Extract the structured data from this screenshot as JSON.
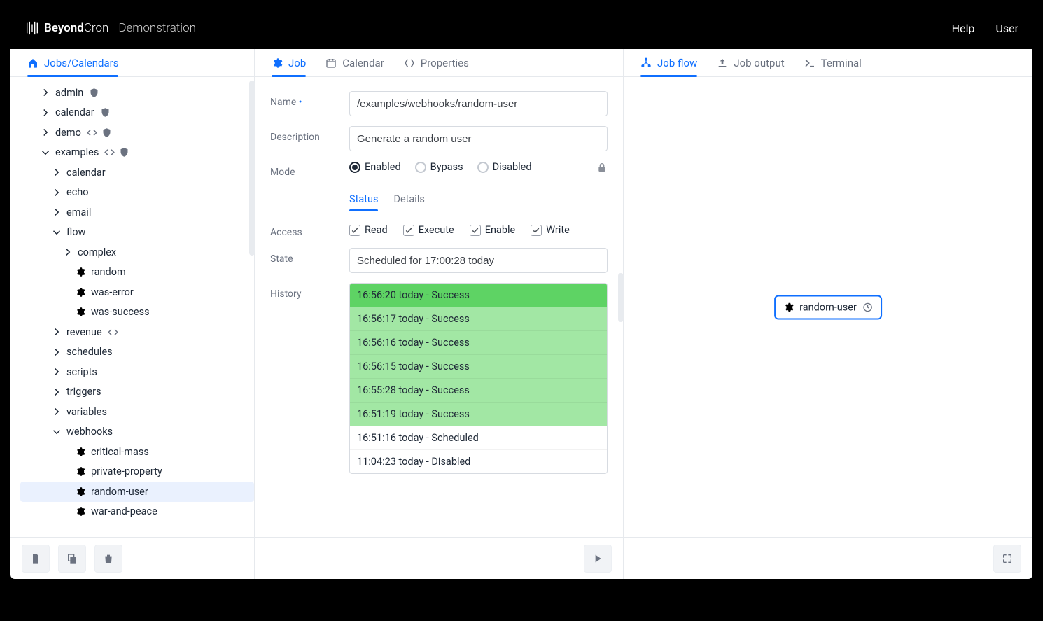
{
  "brand": {
    "bold": "Beyond",
    "thin": "Cron",
    "tenant": "Demonstration"
  },
  "header": {
    "help": "Help",
    "user": "User"
  },
  "leftTabs": {
    "jobs": "Jobs/Calendars"
  },
  "tree": {
    "admin": "admin",
    "calendar": "calendar",
    "demo": "demo",
    "examples": "examples",
    "ex_calendar": "calendar",
    "echo": "echo",
    "email": "email",
    "flow": "flow",
    "complex": "complex",
    "random": "random",
    "was_error": "was-error",
    "was_success": "was-success",
    "revenue": "revenue",
    "schedules": "schedules",
    "scripts": "scripts",
    "triggers": "triggers",
    "variables": "variables",
    "webhooks": "webhooks",
    "critical_mass": "critical-mass",
    "private_property": "private-property",
    "random_user": "random-user",
    "war_and_peace": "war-and-peace"
  },
  "midTabs": {
    "job": "Job",
    "calendar": "Calendar",
    "properties": "Properties"
  },
  "form": {
    "name_label": "Name",
    "name_value": "/examples/webhooks/random-user",
    "desc_label": "Description",
    "desc_value": "Generate a random user",
    "mode_label": "Mode",
    "mode_enabled": "Enabled",
    "mode_bypass": "Bypass",
    "mode_disabled": "Disabled",
    "subtab_status": "Status",
    "subtab_details": "Details",
    "access_label": "Access",
    "access": {
      "read": "Read",
      "execute": "Execute",
      "enable": "Enable",
      "write": "Write"
    },
    "state_label": "State",
    "state_value": "Scheduled for 17:00:28 today",
    "history_label": "History",
    "history": [
      {
        "text": "16:56:20 today - Success",
        "kind": "successFirst"
      },
      {
        "text": "16:56:17 today - Success",
        "kind": "success"
      },
      {
        "text": "16:56:16 today - Success",
        "kind": "success"
      },
      {
        "text": "16:56:15 today - Success",
        "kind": "success"
      },
      {
        "text": "16:55:28 today - Success",
        "kind": "success"
      },
      {
        "text": "16:51:19 today - Success",
        "kind": "success"
      },
      {
        "text": "16:51:16 today - Scheduled",
        "kind": "plain"
      },
      {
        "text": "11:04:23 today - Disabled",
        "kind": "plain"
      }
    ]
  },
  "rightTabs": {
    "flow": "Job flow",
    "output": "Job output",
    "terminal": "Terminal"
  },
  "flow": {
    "node": "random-user"
  }
}
